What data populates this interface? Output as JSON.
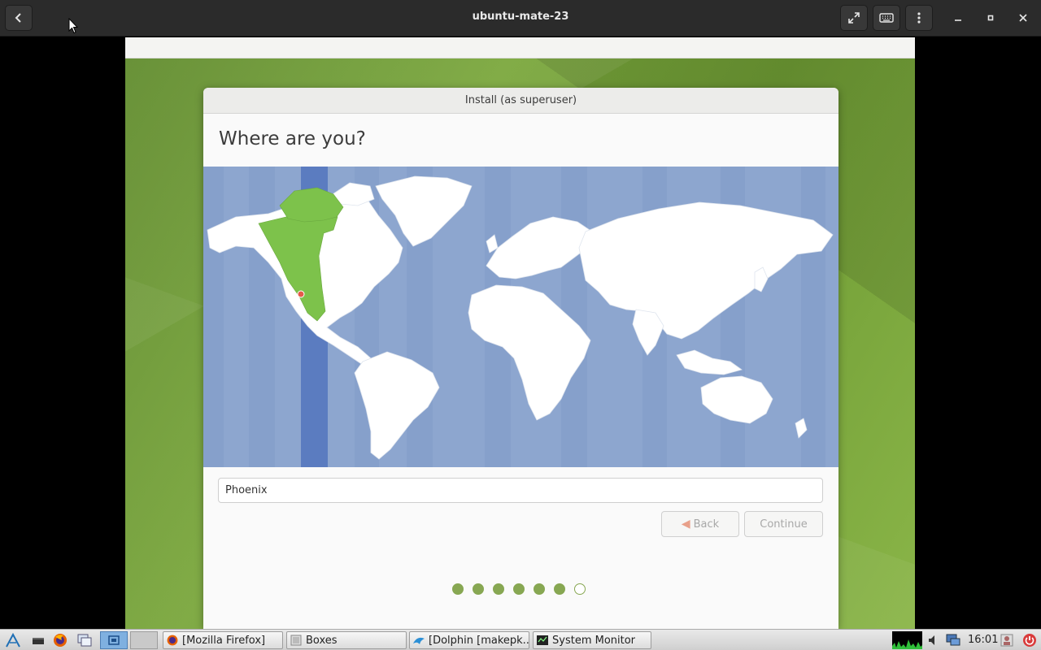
{
  "header": {
    "title": "ubuntu-mate-23"
  },
  "installer": {
    "window_title": "Install (as superuser)",
    "heading": "Where are you?",
    "location_value": "Phoenix",
    "back_label": "Back",
    "continue_label": "Continue",
    "progress": {
      "total_steps": 7,
      "completed_steps": 6
    }
  },
  "taskbar": {
    "tasks": [
      {
        "label": "[Mozilla Firefox]"
      },
      {
        "label": "Boxes"
      },
      {
        "label": "[Dolphin [makepk..."
      },
      {
        "label": "System Monitor"
      }
    ],
    "clock": "16:01"
  },
  "colors": {
    "accent_green": "#87a752",
    "map_ocean": "#8da6cf",
    "selected_timezone": "#5b7cc0",
    "timezone_land": "#7dc24b"
  }
}
